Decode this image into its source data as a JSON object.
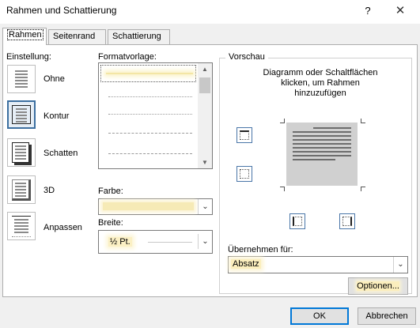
{
  "window": {
    "title": "Rahmen und Schattierung",
    "help": "?",
    "close": "✕"
  },
  "tabs": [
    {
      "label": "Rahmen",
      "active": true
    },
    {
      "label": "Seitenrand",
      "active": false
    },
    {
      "label": "Schattierung",
      "active": false
    }
  ],
  "einstellung": {
    "label": "Einstellung:",
    "presets": [
      {
        "label": "Ohne",
        "icon": "none-preset-icon",
        "selected": false
      },
      {
        "label": "Kontur",
        "icon": "box-preset-icon",
        "selected": true
      },
      {
        "label": "Schatten",
        "icon": "shadow-preset-icon",
        "selected": false
      },
      {
        "label": "3D",
        "icon": "3d-preset-icon",
        "selected": false
      },
      {
        "label": "Anpassen",
        "icon": "custom-preset-icon",
        "selected": false
      }
    ]
  },
  "formatvorlage": {
    "label": "Formatvorlage:",
    "styles": [
      "solid",
      "dotted",
      "dashed-small",
      "dashed",
      "dash-dot"
    ]
  },
  "farbe": {
    "label": "Farbe:",
    "value": ""
  },
  "breite": {
    "label": "Breite:",
    "value": "½ Pt."
  },
  "vorschau": {
    "label": "Vorschau",
    "hint_line1": "Diagramm oder Schaltflächen",
    "hint_line2": "klicken, um Rahmen",
    "hint_line3": "hinzuzufügen"
  },
  "uebernehmen": {
    "label": "Übernehmen für:",
    "value": "Absatz"
  },
  "buttons": {
    "optionen": "Optionen...",
    "ok": "OK",
    "cancel": "Abbrechen"
  },
  "colors": {
    "accent": "#0078d7",
    "selection_highlight": "#fbeebd"
  }
}
